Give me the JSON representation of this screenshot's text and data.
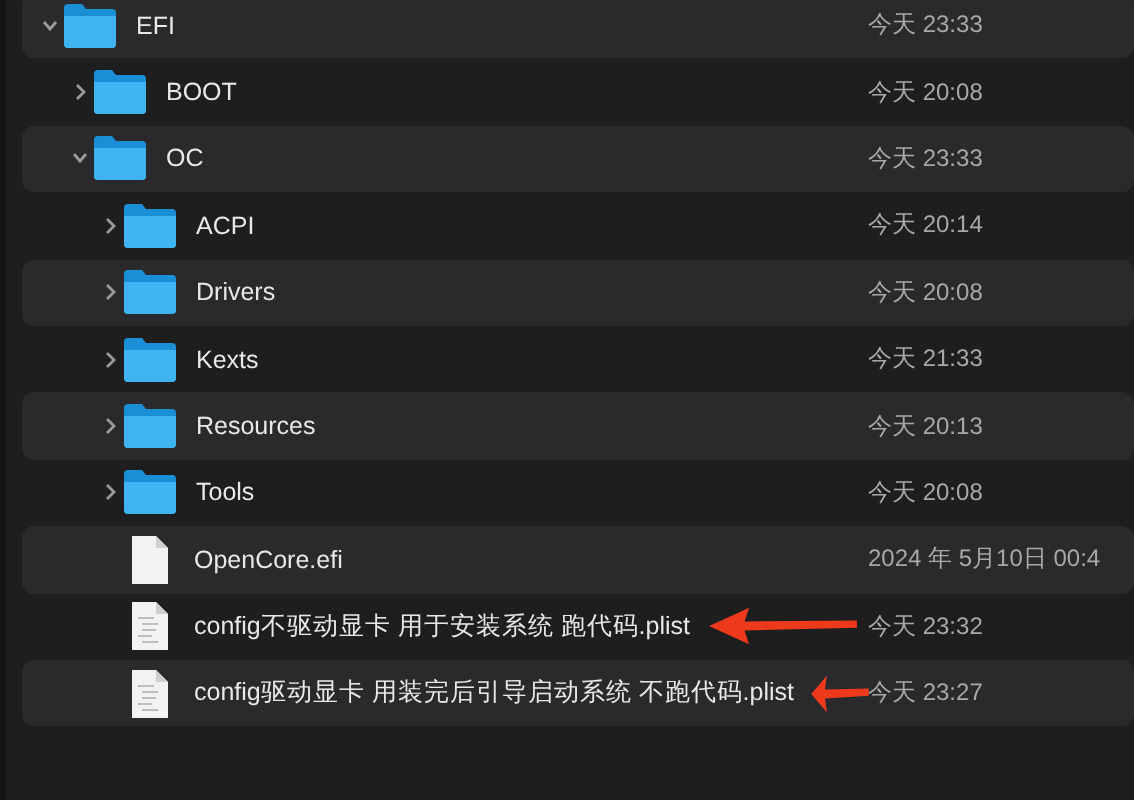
{
  "items": [
    {
      "name": "EFI",
      "kind": "folder",
      "expanded": true,
      "date": "今天 23:33",
      "children": [
        {
          "name": "BOOT",
          "kind": "folder",
          "expanded": false,
          "date": "今天 20:08"
        },
        {
          "name": "OC",
          "kind": "folder",
          "expanded": true,
          "date": "今天 23:33",
          "children": [
            {
              "name": "ACPI",
              "kind": "folder",
              "expanded": false,
              "date": "今天 20:14"
            },
            {
              "name": "Drivers",
              "kind": "folder",
              "expanded": false,
              "date": "今天 20:08"
            },
            {
              "name": "Kexts",
              "kind": "folder",
              "expanded": false,
              "date": "今天 21:33"
            },
            {
              "name": "Resources",
              "kind": "folder",
              "expanded": false,
              "date": "今天 20:13"
            },
            {
              "name": "Tools",
              "kind": "folder",
              "expanded": false,
              "date": "今天 20:08"
            },
            {
              "name": "OpenCore.efi",
              "kind": "file",
              "date": "2024 年 5月10日 00:4"
            },
            {
              "name": "config不驱动显卡 用于安装系统 跑代码.plist",
              "kind": "plist",
              "date": "今天 23:32",
              "arrow": true
            },
            {
              "name": "config驱动显卡 用装完后引导启动系统 不跑代码.plist",
              "kind": "plist",
              "date": "今天 23:27",
              "arrow": true
            }
          ]
        }
      ]
    }
  ]
}
